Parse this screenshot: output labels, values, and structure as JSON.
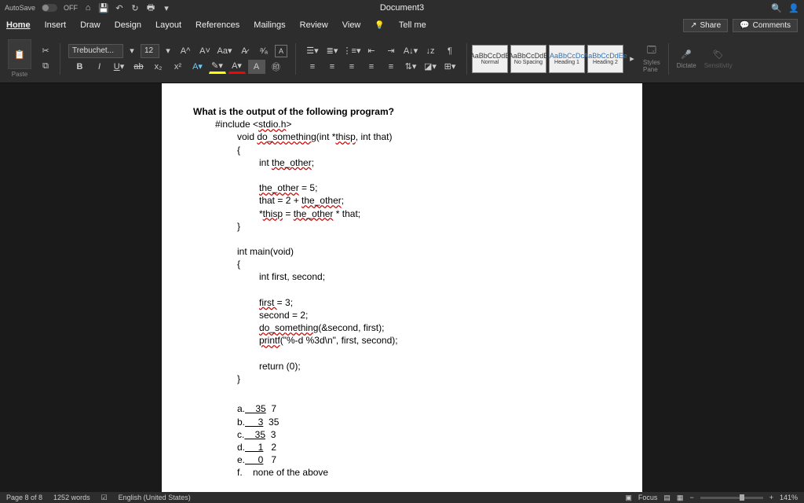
{
  "titlebar": {
    "autosave_label": "AutoSave",
    "autosave_state": "OFF",
    "doc_title": "Document3"
  },
  "tabs": [
    "Home",
    "Insert",
    "Draw",
    "Design",
    "Layout",
    "References",
    "Mailings",
    "Review",
    "View"
  ],
  "tellme": "Tell me",
  "share_btn": "Share",
  "comments_btn": "Comments",
  "ribbon": {
    "paste_label": "Paste",
    "font_name": "Trebuchet...",
    "font_size": "12",
    "styles": [
      {
        "preview": "AaBbCcDdE",
        "name": "Normal"
      },
      {
        "preview": "AaBbCcDdE",
        "name": "No Spacing"
      },
      {
        "preview": "AaBbCcDc",
        "name": "Heading 1"
      },
      {
        "preview": "AaBbCcDdEe",
        "name": "Heading 2"
      }
    ],
    "styles_pane": "Styles\nPane",
    "dictate": "Dictate",
    "sensitivity": "Sensitivity"
  },
  "document": {
    "question": "What is the output of the following program?",
    "code": {
      "include": "#include <stdio.h>",
      "fn_sig": "void do_something(int *thisp, int that)",
      "open1": "{",
      "decl": "int the_other;",
      "l1": "the_other = 5;",
      "l2": "that = 2 + the_other;",
      "l3": "*thisp = the_other * that;",
      "close1": "}",
      "main_sig": "int main(void)",
      "open2": "{",
      "m_decl": "int first, second;",
      "m1": "first  = 3;",
      "m2": "second = 2;",
      "m3": "do_something(&second, first);",
      "m4": "printf(\"%-d %3d\\n\", first, second);",
      "m_ret": "return (0);",
      "close2": "}"
    },
    "options": [
      "a.     35  7",
      "b.     3  35",
      "c.     35  3",
      "d.     1   2",
      "e.     0   7",
      "f.    none of the above"
    ]
  },
  "statusbar": {
    "page": "Page 8 of 8",
    "words": "1252 words",
    "lang": "English (United States)",
    "focus": "Focus",
    "zoom": "141%"
  }
}
